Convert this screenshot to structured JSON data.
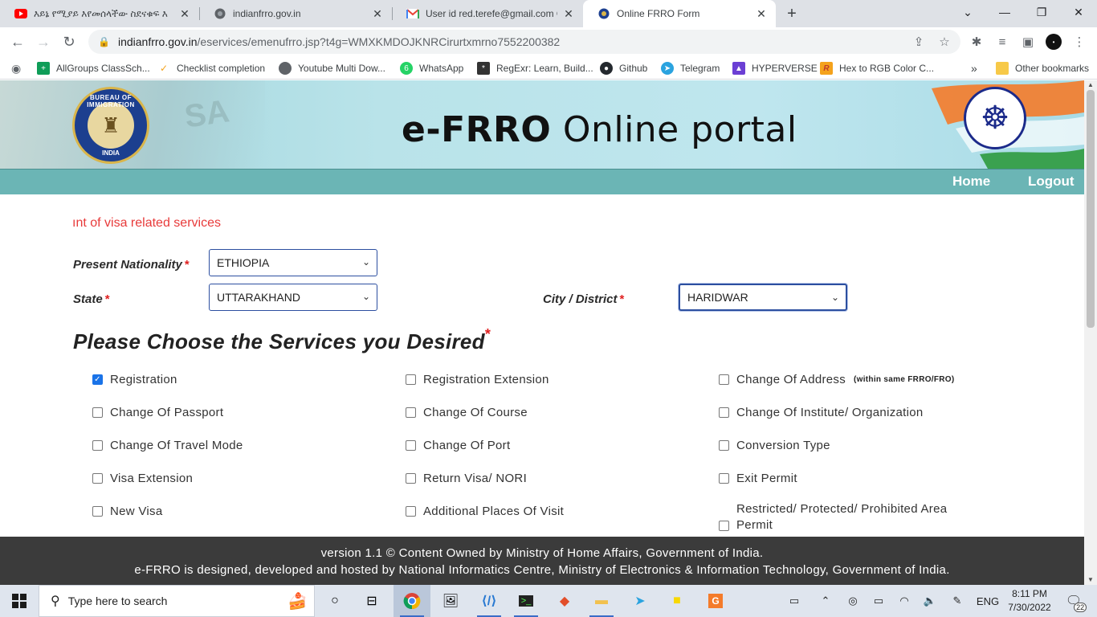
{
  "browser": {
    "tabs": [
      {
        "title": "እይኔ የሚያይ እየመሰላችው ስደናቁፍ እ",
        "favicon": "youtube-icon",
        "active": false
      },
      {
        "title": "indianfrro.gov.in",
        "favicon": "globe-icon",
        "active": false
      },
      {
        "title": "User id red.terefe@gmail.com OT",
        "favicon": "gmail-icon",
        "active": false
      },
      {
        "title": "Online FRRO Form",
        "favicon": "emblem-icon",
        "active": true
      }
    ],
    "new_tab_label": "+",
    "url_host": "indianfrro.gov.in",
    "url_path": "/eservices/emenufrro.jsp?t4g=WMXKMDOJKNRCirurtxmrno7552200382",
    "bookmarks": [
      {
        "label": "AllGroups ClassSch...",
        "icon": "sheets-icon",
        "color": "#0f9d58"
      },
      {
        "label": "Checklist completion",
        "icon": "checklist-icon",
        "color": "#f4a21c"
      },
      {
        "label": "Youtube Multi Dow...",
        "icon": "globe-icon",
        "color": "#5f6368"
      },
      {
        "label": "WhatsApp",
        "icon": "whatsapp-icon",
        "color": "#25d366"
      },
      {
        "label": "RegExr: Learn, Build...",
        "icon": "regexr-icon",
        "color": "#333333"
      },
      {
        "label": "Github",
        "icon": "github-icon",
        "color": "#24292e"
      },
      {
        "label": "Telegram",
        "icon": "telegram-icon",
        "color": "#2aa3df"
      },
      {
        "label": "HYPERVERSE",
        "icon": "hyperverse-icon",
        "color": "#6b3fd4"
      },
      {
        "label": "Hex to RGB Color C...",
        "icon": "hex-icon",
        "color": "#c0392b"
      }
    ],
    "more_bookmarks": "»",
    "other_bookmarks": "Other bookmarks"
  },
  "portal": {
    "logo_top": "BUREAU OF IMMIGRATION",
    "logo_bottom": "INDIA",
    "title_bold": "e-FRRO",
    "title_light": "Online portal",
    "nav": {
      "home": "Home",
      "logout": "Logout"
    },
    "marquee": "ınt of visa related services"
  },
  "form": {
    "nationality": {
      "label": "Present Nationality",
      "value": "ETHIOPIA"
    },
    "state": {
      "label": "State",
      "value": "UTTARAKHAND"
    },
    "city": {
      "label": "City / District",
      "value": "HARIDWAR"
    },
    "required_mark": "*",
    "services_title": "Please Choose the Services you Desired",
    "services": [
      {
        "label": "Registration",
        "checked": true
      },
      {
        "label": "Registration Extension",
        "checked": false
      },
      {
        "label": "Change Of Address",
        "note": "(within same FRRO/FRO)",
        "checked": false
      },
      {
        "label": "Change Of Passport",
        "checked": false
      },
      {
        "label": "Change Of Course",
        "checked": false
      },
      {
        "label": "Change Of Institute/ Organization",
        "checked": false
      },
      {
        "label": "Change Of Travel Mode",
        "checked": false
      },
      {
        "label": "Change Of Port",
        "checked": false
      },
      {
        "label": "Conversion Type",
        "checked": false
      },
      {
        "label": "Visa Extension",
        "checked": false
      },
      {
        "label": "Return Visa/ NORI",
        "checked": false
      },
      {
        "label": "Exit Permit",
        "checked": false
      },
      {
        "label": "New Visa",
        "checked": false
      },
      {
        "label": "Additional Places Of Visit",
        "checked": false
      },
      {
        "label": "Restricted/ Protected/ Prohibited Area Permit",
        "label_line1": "Restricted/ Protected/ Prohibited Area",
        "label_line2": "Permit",
        "checked": false
      }
    ]
  },
  "footer": {
    "line1": "version 1.1 © Content Owned by Ministry of Home Affairs, Government of India.",
    "line2": "e-FRRO is designed, developed and hosted by National Informatics Centre, Ministry of Electronics & Information Technology, Government of India."
  },
  "taskbar": {
    "search_placeholder": "Type here to search",
    "language": "ENG",
    "time": "8:11 PM",
    "date": "7/30/2022",
    "notifications": "22"
  }
}
